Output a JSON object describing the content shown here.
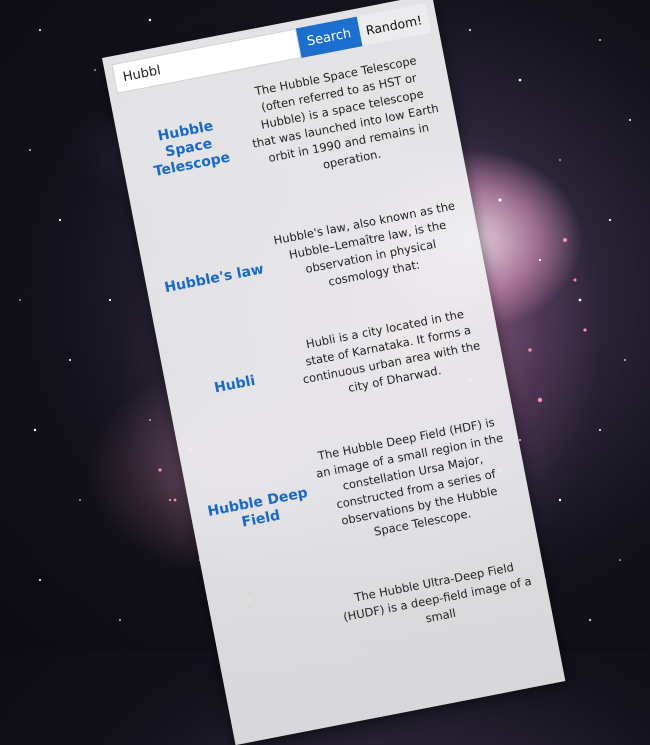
{
  "search": {
    "value": "Hubbl",
    "button_label": "Search",
    "random_label": "Random!"
  },
  "results": [
    {
      "title": "Hubble Space Telescope",
      "extract": "The Hubble Space Telescope (often referred to as HST or Hubble) is a space telescope that was launched into low Earth orbit in 1990 and remains in operation."
    },
    {
      "title": "Hubble's law",
      "extract": "Hubble's law, also known as the Hubble–Lemaître law, is the observation in physical cosmology that:"
    },
    {
      "title": "Hubli",
      "extract": "Hubli is a city located in the state of Karnataka. It forms a continuous urban area with the city of Dharwad."
    },
    {
      "title": "Hubble Deep Field",
      "extract": "The Hubble Deep Field (HDF) is an image of a small region in the constellation Ursa Major, constructed from a series of observations by the Hubble Space Telescope."
    },
    {
      "title": "",
      "extract": "The Hubble Ultra-Deep Field (HUDF) is a deep-field image of a small"
    }
  ],
  "colors": {
    "accent": "#1d6fcf",
    "title": "#1769cc"
  }
}
